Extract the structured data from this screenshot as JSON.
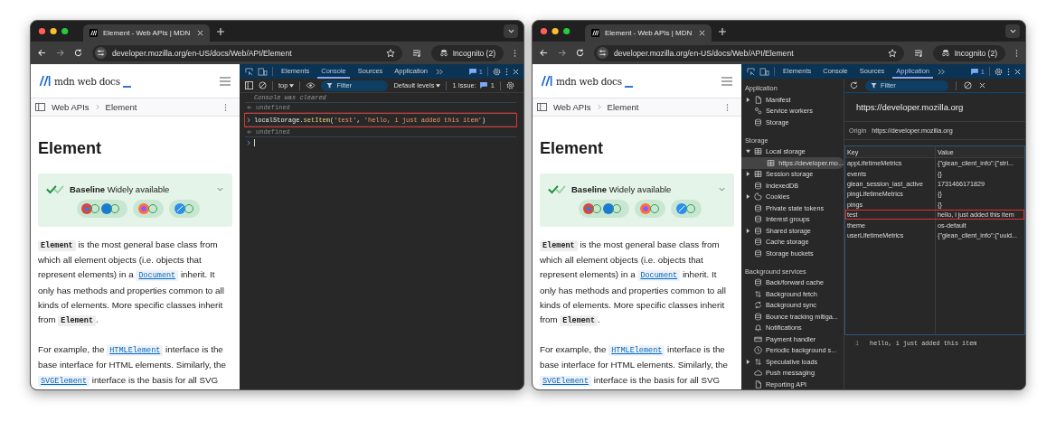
{
  "windows": [
    {
      "tab": {
        "title": "Element - Web APIs | MDN"
      },
      "url": "developer.mozilla.org/en-US/docs/Web/API/Element",
      "incognito": "Incognito (2)",
      "page": {
        "logo": "mdn web docs",
        "breadcrumbs": [
          "Web APIs",
          "Element"
        ],
        "title": "Element",
        "baseline": "**Baseline** Widely available",
        "paragraphs": [
          [
            {
              "kind": "code",
              "text": "Element"
            },
            {
              "kind": "text",
              "text": " is the most general base class from which all element objects (i.e. objects that represent elements) in a "
            },
            {
              "kind": "link",
              "text": "Document"
            },
            {
              "kind": "text",
              "text": " inherit. It only has methods and properties common to all kinds of elements. More specific classes inherit from "
            },
            {
              "kind": "code",
              "text": "Element"
            },
            {
              "kind": "text",
              "text": "."
            }
          ],
          [
            {
              "kind": "text",
              "text": "For example, the "
            },
            {
              "kind": "link",
              "text": "HTMLElement"
            },
            {
              "kind": "text",
              "text": " interface is the base interface for HTML elements. Similarly, the "
            },
            {
              "kind": "link",
              "text": "SVGElement"
            },
            {
              "kind": "text",
              "text": " interface is the basis for all SVG"
            }
          ]
        ]
      },
      "devtools": {
        "kind": "console",
        "tabs": [
          {
            "label": "Elements",
            "selected": false
          },
          {
            "label": "Console",
            "selected": true
          },
          {
            "label": "Sources",
            "selected": false
          },
          {
            "label": "Application",
            "selected": false
          }
        ],
        "message_count": "1",
        "console": {
          "context": "top",
          "filter_placeholder": "Filter",
          "levels": "Default levels",
          "issues_label": "1 Issue:",
          "issues_count": "1",
          "lines": [
            {
              "kind": "info",
              "text": "Console was cleared"
            },
            {
              "kind": "result",
              "text": "undefined"
            },
            {
              "kind": "input",
              "highlighted": true,
              "parts": [
                {
                  "kind": "plain",
                  "text": "localStorage."
                },
                {
                  "kind": "method",
                  "text": "setItem"
                },
                {
                  "kind": "plain",
                  "text": "("
                },
                {
                  "kind": "string",
                  "text": "'test'"
                },
                {
                  "kind": "plain",
                  "text": ", "
                },
                {
                  "kind": "string",
                  "text": "'hello, i just added this item'"
                },
                {
                  "kind": "plain",
                  "text": ")"
                }
              ]
            },
            {
              "kind": "result",
              "text": "undefined"
            },
            {
              "kind": "prompt"
            }
          ]
        }
      }
    },
    {
      "tab": {
        "title": "Element - Web APIs | MDN"
      },
      "url": "developer.mozilla.org/en-US/docs/Web/API/Element",
      "incognito": "Incognito (2)",
      "page": {
        "logo": "mdn web docs",
        "breadcrumbs": [
          "Web APIs",
          "Element"
        ],
        "title": "Element",
        "baseline": "**Baseline** Widely available",
        "paragraphs": [
          [
            {
              "kind": "code",
              "text": "Element"
            },
            {
              "kind": "text",
              "text": " is the most general base class from which all element objects (i.e. objects that represent elements) in a "
            },
            {
              "kind": "link",
              "text": "Document"
            },
            {
              "kind": "text",
              "text": " inherit. It only has methods and properties common to all kinds of elements. More specific classes inherit from "
            },
            {
              "kind": "code",
              "text": "Element"
            },
            {
              "kind": "text",
              "text": "."
            }
          ],
          [
            {
              "kind": "text",
              "text": "For example, the "
            },
            {
              "kind": "link",
              "text": "HTMLElement"
            },
            {
              "kind": "text",
              "text": " interface is the base interface for HTML elements. Similarly, the "
            },
            {
              "kind": "link",
              "text": "SVGElement"
            },
            {
              "kind": "text",
              "text": " interface is the basis for all SVG"
            }
          ]
        ]
      },
      "devtools": {
        "kind": "application",
        "tabs": [
          {
            "label": "Elements",
            "selected": false
          },
          {
            "label": "Console",
            "selected": false
          },
          {
            "label": "Sources",
            "selected": false
          },
          {
            "label": "Application",
            "selected": true
          }
        ],
        "message_count": "1",
        "sidebar": [
          {
            "heading": "Application",
            "items": [
              {
                "label": "Manifest",
                "kind": "document",
                "expanded": false,
                "selected": false
              },
              {
                "label": "Service workers",
                "kind": "workers",
                "selected": false
              },
              {
                "label": "Storage",
                "kind": "database",
                "selected": false
              }
            ]
          },
          {
            "heading": "Storage",
            "items": [
              {
                "label": "Local storage",
                "kind": "table",
                "expanded": true,
                "selected": false,
                "children": [
                  {
                    "label": "https://developer.mo...",
                    "kind": "table",
                    "selected": true
                  }
                ]
              },
              {
                "label": "Session storage",
                "kind": "table",
                "expanded": false,
                "selected": false
              },
              {
                "label": "IndexedDB",
                "kind": "database",
                "selected": false
              },
              {
                "label": "Cookies",
                "kind": "cookie",
                "expanded": false,
                "selected": false
              },
              {
                "label": "Private state tokens",
                "kind": "database",
                "selected": false
              },
              {
                "label": "Interest groups",
                "kind": "database",
                "selected": false
              },
              {
                "label": "Shared storage",
                "kind": "database",
                "expanded": false,
                "selected": false
              },
              {
                "label": "Cache storage",
                "kind": "database",
                "selected": false
              },
              {
                "label": "Storage buckets",
                "kind": "database",
                "selected": false
              }
            ]
          },
          {
            "heading": "Background services",
            "items": [
              {
                "label": "Back/forward cache",
                "kind": "database",
                "selected": false
              },
              {
                "label": "Background fetch",
                "kind": "fetch",
                "selected": false
              },
              {
                "label": "Background sync",
                "kind": "sync",
                "selected": false
              },
              {
                "label": "Bounce tracking mitiga...",
                "kind": "database",
                "selected": false
              },
              {
                "label": "Notifications",
                "kind": "bell",
                "selected": false
              },
              {
                "label": "Payment handler",
                "kind": "card",
                "selected": false
              },
              {
                "label": "Periodic background s...",
                "kind": "clock",
                "selected": false
              },
              {
                "label": "Speculative loads",
                "kind": "fetch",
                "expanded": false,
                "selected": false
              },
              {
                "label": "Push messaging",
                "kind": "cloud",
                "selected": false
              },
              {
                "label": "Reporting API",
                "kind": "document",
                "selected": false
              }
            ]
          }
        ],
        "storage": {
          "filter_placeholder": "Filter",
          "origin_title": "https://developer.mozilla.org",
          "origin_label": "Origin",
          "origin_value": "https://developer.mozilla.org",
          "columns": [
            "Key",
            "Value"
          ],
          "rows": [
            {
              "key": "appLifetimeMetrics",
              "value": "{\"glean_client_info\":{\"stri...",
              "highlighted": false
            },
            {
              "key": "events",
              "value": "{}",
              "highlighted": false
            },
            {
              "key": "glean_session_last_active",
              "value": "1731466171829",
              "highlighted": false
            },
            {
              "key": "pingLifetimeMetrics",
              "value": "{}",
              "highlighted": false
            },
            {
              "key": "pings",
              "value": "{}",
              "highlighted": false
            },
            {
              "key": "test",
              "value": "hello, i just added this item",
              "highlighted": true
            },
            {
              "key": "theme",
              "value": "os-default",
              "highlighted": false
            },
            {
              "key": "userLifetimeMetrics",
              "value": "{\"glean_client_info\":{\"uuid...",
              "highlighted": false
            }
          ],
          "preview": {
            "line_number": "1",
            "text": "hello, i just added this item"
          }
        }
      }
    }
  ]
}
